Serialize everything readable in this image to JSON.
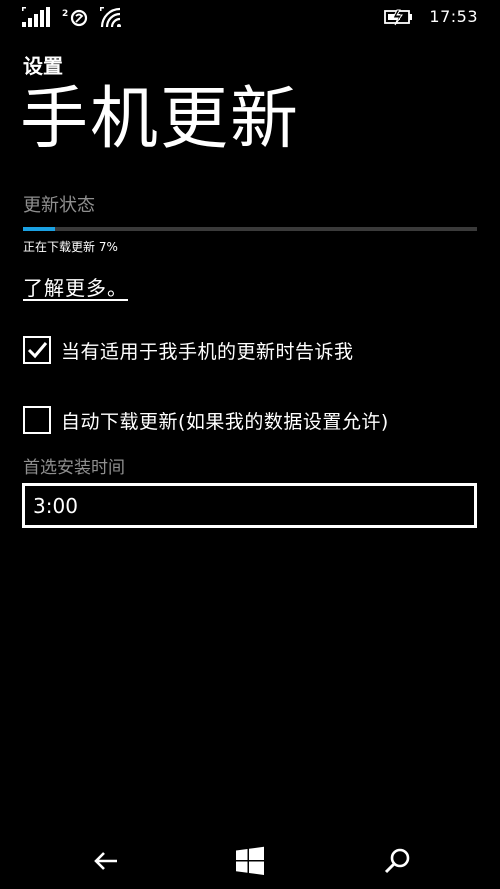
{
  "status_bar": {
    "time": "17:53"
  },
  "header": {
    "app_title": "设置",
    "page_title": "手机更新"
  },
  "update": {
    "status_label": "更新状态",
    "progress_text": "正在下载更新 7%",
    "progress": 0.07,
    "learn_more": "了解更多。"
  },
  "options": {
    "notify_label": "当有适用于我手机的更新时告诉我",
    "notify_checked": true,
    "auto_download_label": "自动下载更新(如果我的数据设置允许)",
    "auto_download_checked": false
  },
  "install_time": {
    "label": "首选安装时间",
    "value": "3:00"
  },
  "nav": {
    "icons": [
      "back-arrow-icon",
      "windows-start-icon",
      "search-icon"
    ]
  },
  "colors": {
    "accent": "#1ba1e2",
    "background": "#000000",
    "secondary_text": "#8f8f8f"
  }
}
